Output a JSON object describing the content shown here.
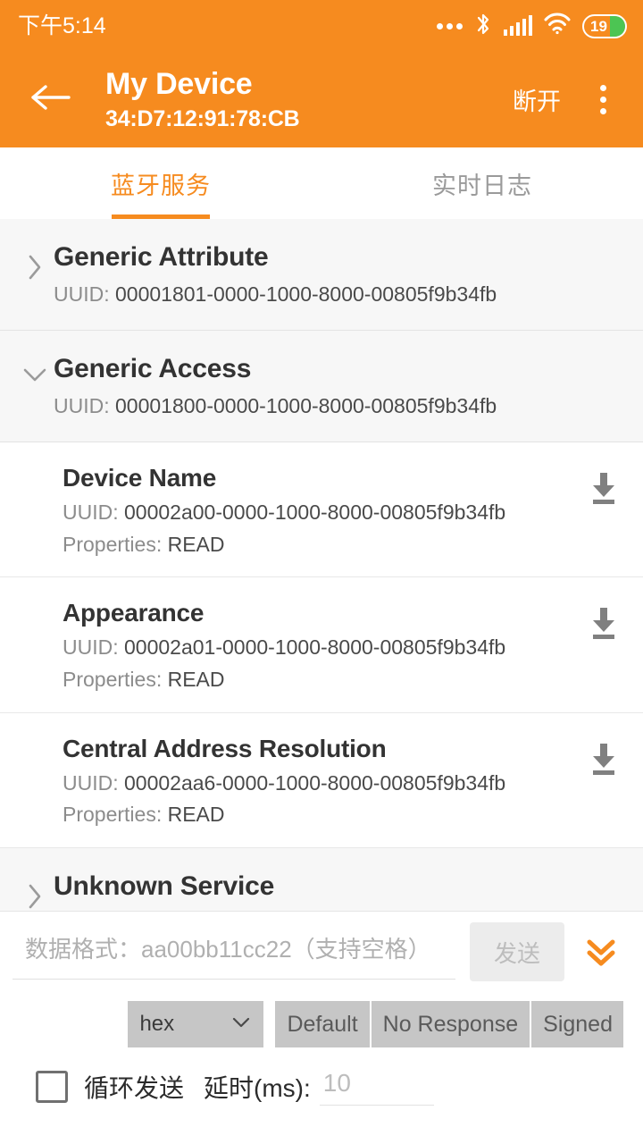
{
  "statusbar": {
    "time": "下午5:14",
    "icons": [
      "more-dots-icon",
      "bluetooth-icon",
      "signal-icon",
      "wifi-icon",
      "battery-icon"
    ],
    "battery_level": "19"
  },
  "appbar": {
    "back_icon": "back-arrow-icon",
    "title": "My Device",
    "subtitle": "34:D7:12:91:78:CB",
    "action_label": "断开",
    "overflow_icon": "overflow-menu-icon",
    "accent_color": "#F68B1F"
  },
  "tabs": [
    {
      "label": "蓝牙服务",
      "active": true
    },
    {
      "label": "实时日志",
      "active": false
    }
  ],
  "labels": {
    "uuid_prefix": "UUID: ",
    "properties_prefix": "Properties: "
  },
  "services": [
    {
      "name": "Generic Attribute",
      "uuid": "00001801-0000-1000-8000-00805f9b34fb",
      "expanded": false,
      "chevron": "chevron-right-icon",
      "characteristics": []
    },
    {
      "name": "Generic Access",
      "uuid": "00001800-0000-1000-8000-00805f9b34fb",
      "expanded": true,
      "chevron": "chevron-down-icon",
      "characteristics": [
        {
          "name": "Device Name",
          "uuid": "00002a00-0000-1000-8000-00805f9b34fb",
          "properties": "READ",
          "action_icon": "download-icon"
        },
        {
          "name": "Appearance",
          "uuid": "00002a01-0000-1000-8000-00805f9b34fb",
          "properties": "READ",
          "action_icon": "download-icon"
        },
        {
          "name": "Central Address Resolution",
          "uuid": "00002aa6-0000-1000-8000-00805f9b34fb",
          "properties": "READ",
          "action_icon": "download-icon"
        }
      ]
    },
    {
      "name": "Unknown Service",
      "uuid": "",
      "expanded": false,
      "chevron": "chevron-right-icon",
      "characteristics": []
    }
  ],
  "send_panel": {
    "data_input_placeholder": "数据格式：aa00bb11cc22（支持空格）",
    "data_input_value": "",
    "send_label": "发送",
    "send_disabled": true,
    "expand_icon": "double-chevron-down-icon",
    "format_value": "hex",
    "format_chevron": "chevron-down-icon",
    "write_modes": [
      "Default",
      "No Response",
      "Signed"
    ],
    "loop_checkbox_checked": false,
    "loop_label": "循环发送",
    "delay_label": "延时(ms):",
    "delay_placeholder": "10",
    "delay_value": ""
  }
}
